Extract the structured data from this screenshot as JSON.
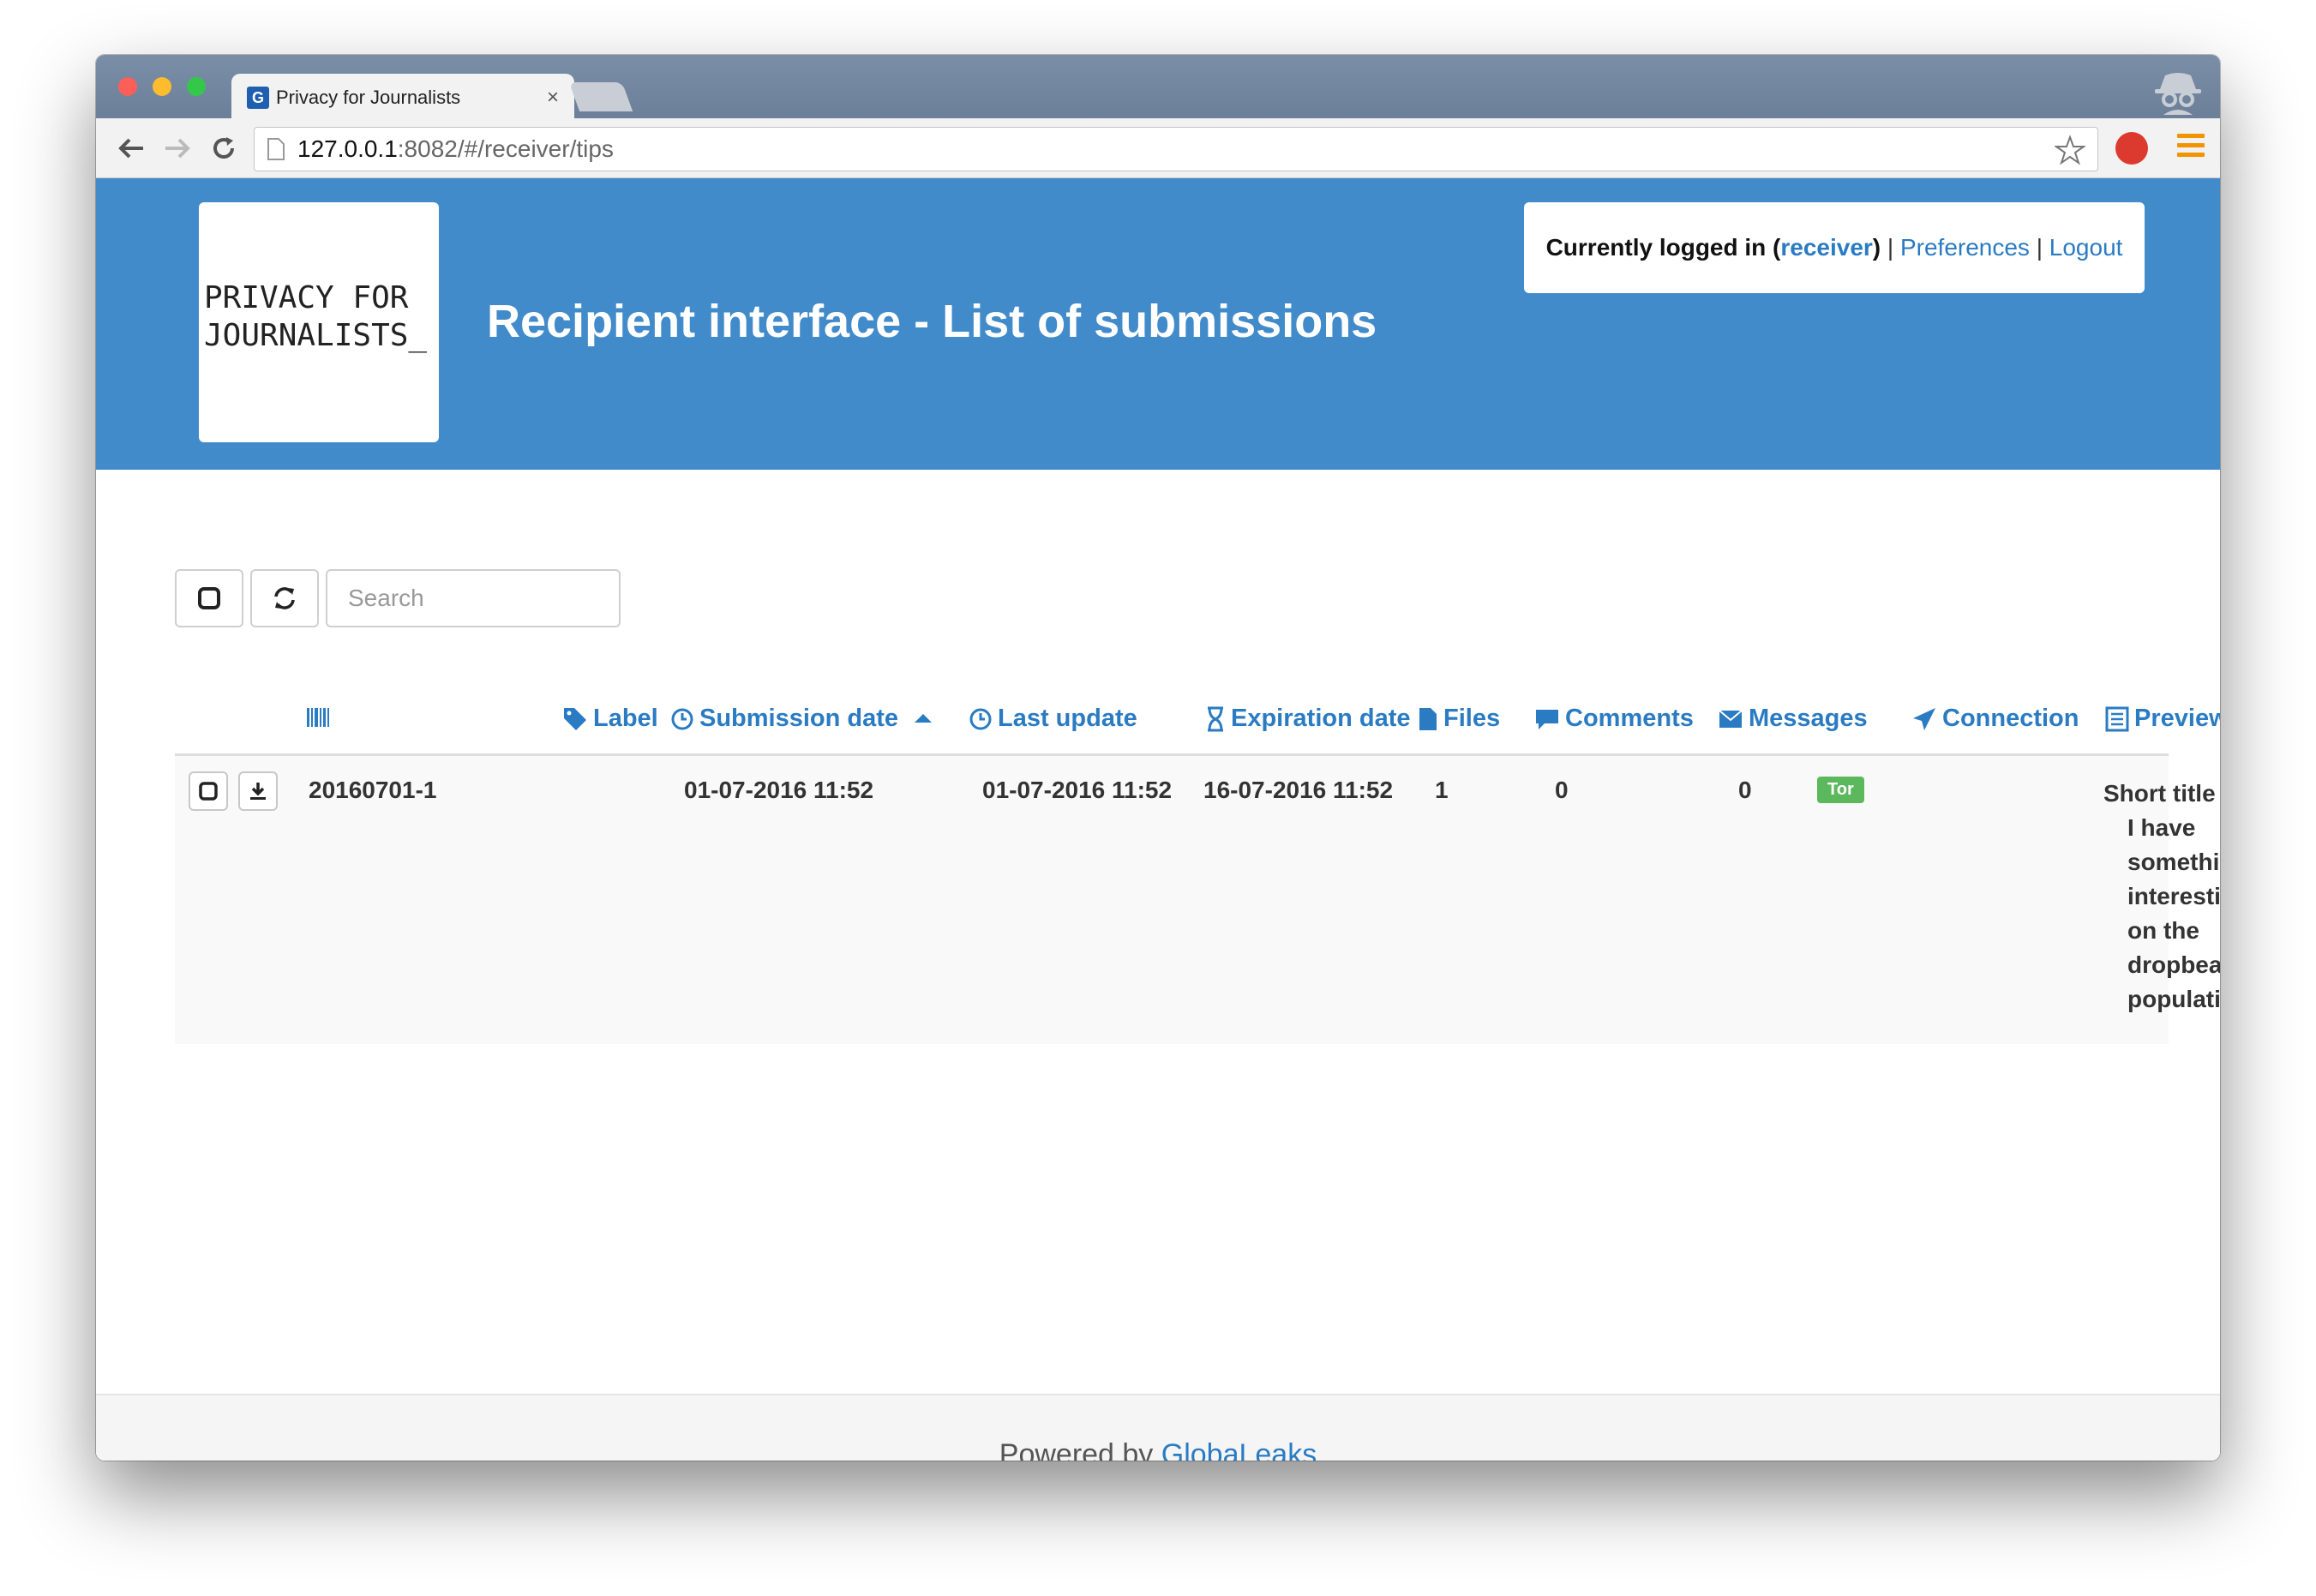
{
  "browser": {
    "tab_title": "Privacy for Journalists",
    "tab_close": "×",
    "url_host": "127.0.0.1",
    "url_rest": ":8082/#/receiver/tips"
  },
  "header": {
    "logo_text": "PRIVACY FOR\nJOURNALISTS_",
    "title": "Recipient interface - List of submissions",
    "logged_in_label": "Currently logged in (",
    "username": "receiver",
    "logged_in_close": ")",
    "separator1": " | ",
    "preferences": "Preferences",
    "separator2": " | ",
    "logout": "Logout"
  },
  "controls": {
    "search_placeholder": "Search"
  },
  "table": {
    "columns": {
      "label": "Label",
      "submission_date": "Submission date",
      "last_update": "Last update",
      "expiration_date": "Expiration date",
      "files": "Files",
      "comments": "Comments",
      "messages": "Messages",
      "connection": "Connection",
      "preview": "Preview"
    },
    "rows": [
      {
        "id": "20160701-1",
        "submission_date": "01-07-2016 11:52",
        "last_update": "01-07-2016 11:52",
        "expiration_date": "16-07-2016 11:52",
        "files": "1",
        "comments": "0",
        "messages": "0",
        "connection": "Tor",
        "preview_title": "Short title",
        "preview_body": "I have something interesting on the dropbear population"
      }
    ]
  },
  "footer": {
    "powered_by": "Powered by ",
    "brand": "GlobaLeaks"
  },
  "colors": {
    "header_bg": "#428bca",
    "link": "#2a7bc2",
    "badge_green": "#5cb85c"
  },
  "icons": [
    "back-arrow-icon",
    "forward-arrow-icon",
    "reload-icon",
    "page-icon",
    "star-icon",
    "barcode-icon",
    "tag-icon",
    "clock-icon",
    "hourglass-icon",
    "file-icon",
    "comment-icon",
    "envelope-icon",
    "send-icon",
    "list-icon",
    "checkbox-icon",
    "refresh-icon",
    "download-icon"
  ]
}
